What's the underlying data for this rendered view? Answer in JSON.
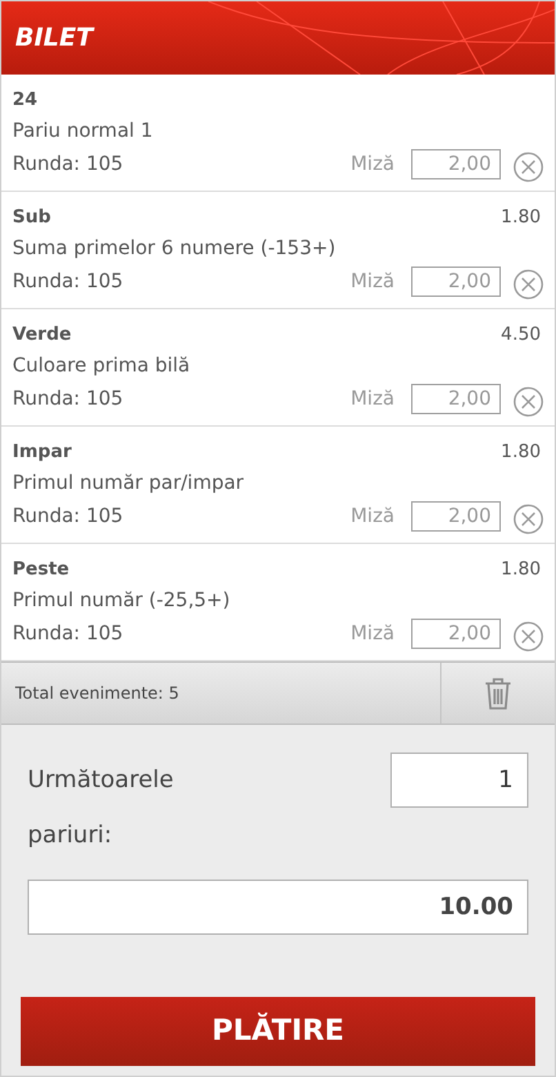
{
  "header": {
    "title": "BILET"
  },
  "bets": [
    {
      "selection": "24",
      "market": "Pariu normal 1",
      "round": "Runda: 105",
      "stake_label": "Miză",
      "stake": "2,00"
    },
    {
      "selection": "Sub",
      "odds": "1.80",
      "market": "Suma primelor 6 numere (-153+)",
      "round": "Runda: 105",
      "stake_label": "Miză",
      "stake": "2,00"
    },
    {
      "selection": "Verde",
      "odds": "4.50",
      "market": "Culoare prima bilă",
      "round": "Runda: 105",
      "stake_label": "Miză",
      "stake": "2,00"
    },
    {
      "selection": "Impar",
      "odds": "1.80",
      "market": "Primul număr par/impar",
      "round": "Runda: 105",
      "stake_label": "Miză",
      "stake": "2,00"
    },
    {
      "selection": "Peste",
      "odds": "1.80",
      "market": "Primul număr (-25,5+)",
      "round": "Runda: 105",
      "stake_label": "Miză",
      "stake": "2,00"
    }
  ],
  "summary": {
    "total": "Total evenimente: 5"
  },
  "next_bets": {
    "label": "Următoarele pariuri:",
    "value": "1"
  },
  "amount": {
    "value": "10.00"
  },
  "pay_button": "PLĂTIRE"
}
